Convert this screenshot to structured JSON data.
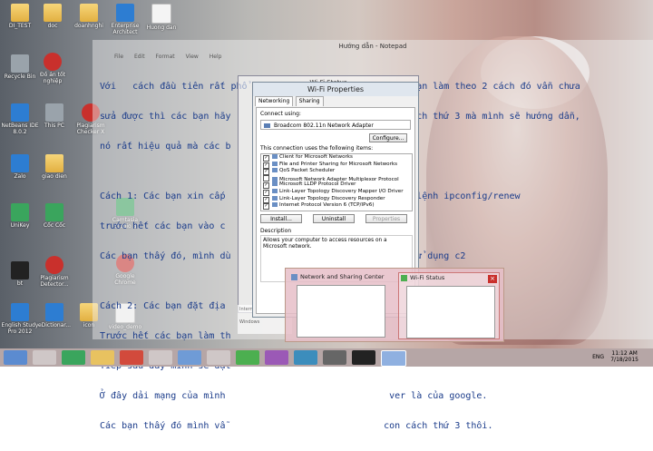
{
  "desktop": {
    "icons": [
      {
        "label": "DI_TEST",
        "kind": "folder"
      },
      {
        "label": "doc",
        "kind": "folder"
      },
      {
        "label": "doanhnghi",
        "kind": "folder"
      },
      {
        "label": "Enterprise Architect",
        "kind": "blue"
      },
      {
        "label": "Huong dan",
        "kind": "doc"
      },
      {
        "label": "Recycle Bin",
        "kind": "gray"
      },
      {
        "label": "Đồ án tốt nghiệp",
        "kind": "red"
      },
      {
        "label": "NetBeans IDE 8.0.2",
        "kind": "blue"
      },
      {
        "label": "This PC",
        "kind": "gray"
      },
      {
        "label": "Plagiarism Checker X",
        "kind": "red"
      },
      {
        "label": "Zalo",
        "kind": "blue"
      },
      {
        "label": "giao dien",
        "kind": "folder"
      },
      {
        "label": "UniKey",
        "kind": "green"
      },
      {
        "label": "Cốc Cốc",
        "kind": "green"
      },
      {
        "label": "Camtasia Studio 8",
        "kind": "green"
      },
      {
        "label": "bt",
        "kind": "black"
      },
      {
        "label": "Plagiarism Detector...",
        "kind": "red"
      },
      {
        "label": "Google Chrome",
        "kind": "red"
      },
      {
        "label": "English Study Pro 2012",
        "kind": "blue"
      },
      {
        "label": "eDictionar...",
        "kind": "blue"
      },
      {
        "label": "icon",
        "kind": "folder"
      },
      {
        "label": "video_demo",
        "kind": "doc"
      }
    ]
  },
  "notepad": {
    "title": "Hướng dẫn - Notepad",
    "menu": [
      "File",
      "Edit",
      "Format",
      "View",
      "Help"
    ],
    "lines": [
      "Với   cách đầu tiên rất phổ biến trên mạng hiện nay, nếu bạn làm theo 2 cách đó vẫn chưa",
      "sửa được thì các bạn hãy                             ng cách thứ 3 mà mình sẽ hướng dẫn,",
      "nó rất hiệu quả mà các b",
      "",
      "Cách 1: Các bạn xin cấp                            ase và lệnh ipconfig/renew",
      "trước hết các bạn vào c",
      "Các bạn thấy đó, mình dù                           nh sẽ sử dụng c2",
      "",
      "Cách 2: Các bạn đặt địa",
      "Trước hết các bạn làm th",
      "Tiếp sau đây mình sẽ đặt",
      "Ở đây dải mạng của mình                              ver là của google.",
      "Các bạn thấy đó mình vẫ                             con cách thứ 3 thôi."
    ]
  },
  "wifi_status": {
    "title": "Wi-Fi Status",
    "labels": [
      "Internet Ac",
      "Windows"
    ]
  },
  "wifi_properties": {
    "title": "Wi-Fi Properties",
    "tabs": [
      "Networking",
      "Sharing"
    ],
    "connect_using_label": "Connect using:",
    "adapter": "Broadcom 802.11n Network Adapter",
    "configure_label": "Configure...",
    "items_label": "This connection uses the following items:",
    "items": [
      {
        "label": "Client for Microsoft Networks",
        "checked": true
      },
      {
        "label": "File and Printer Sharing for Microsoft Networks",
        "checked": true
      },
      {
        "label": "QoS Packet Scheduler",
        "checked": true
      },
      {
        "label": "Microsoft Network Adapter Multiplexor Protocol",
        "checked": false
      },
      {
        "label": "Microsoft LLDP Protocol Driver",
        "checked": true
      },
      {
        "label": "Link-Layer Topology Discovery Mapper I/O Driver",
        "checked": true
      },
      {
        "label": "Link-Layer Topology Discovery Responder",
        "checked": true
      },
      {
        "label": "Internet Protocol Version 6 (TCP/IPv6)",
        "checked": true
      }
    ],
    "install_label": "Install...",
    "uninstall_label": "Uninstall",
    "properties_label": "Properties",
    "description_label": "Description",
    "description_text": "Allows your computer to access resources on a Microsoft network."
  },
  "thumbnails": [
    {
      "title": "Network and Sharing Center"
    },
    {
      "title": "Wi-Fi Status"
    }
  ],
  "taskbar": {
    "lang": "ENG",
    "time": "11:12 AM",
    "date": "7/18/2015"
  },
  "colors": {
    "taskbar": "#b6a6a6",
    "accent": "#3399ff",
    "text_blue": "#1a3b8a"
  }
}
